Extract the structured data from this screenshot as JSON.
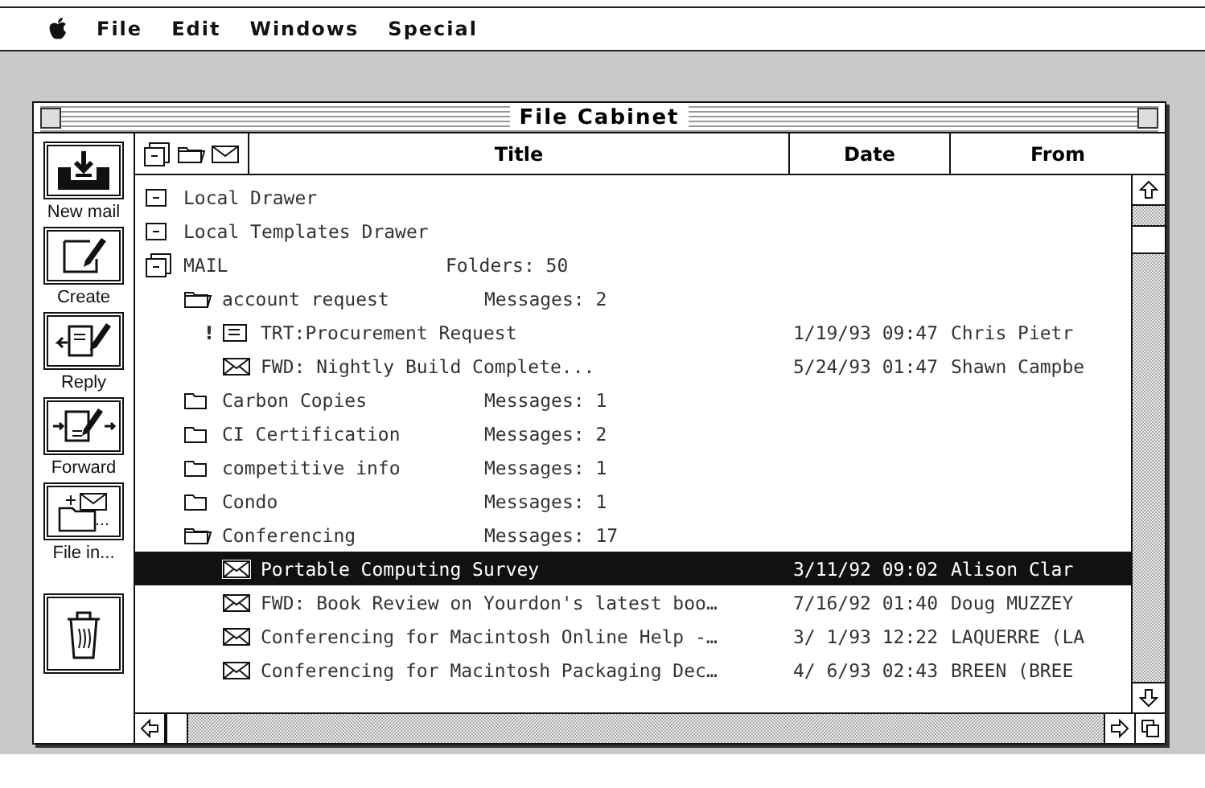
{
  "menu_bar": {
    "items": [
      "File",
      "Edit",
      "Windows",
      "Special"
    ]
  },
  "window": {
    "title": "File Cabinet"
  },
  "toolbar": [
    {
      "kind": "new-mail",
      "label": "New mail"
    },
    {
      "kind": "create",
      "label": "Create"
    },
    {
      "kind": "reply",
      "label": "Reply"
    },
    {
      "kind": "forward",
      "label": "Forward"
    },
    {
      "kind": "file-in",
      "label": "File in..."
    },
    {
      "kind": "trash"
    }
  ],
  "table": {
    "columns": [
      "Title",
      "Date",
      "From"
    ],
    "rows": [
      {
        "kind": "drawer",
        "title": "Local Drawer",
        "selected": false
      },
      {
        "kind": "drawer",
        "title": "Local Templates Drawer",
        "selected": false
      },
      {
        "kind": "cabinet",
        "title": "MAIL",
        "info": "Folders: 50",
        "selected": false,
        "children": [
          {
            "kind": "folder",
            "title": "account request",
            "info": "Messages: 2",
            "expanded": true,
            "selected": false,
            "children": [
              {
                "kind": "note",
                "flag": "!",
                "title": "TRT:Procurement Request",
                "date": "1/19/93 09:47",
                "from": "Chris Pietr",
                "selected": false
              },
              {
                "kind": "message",
                "title": "FWD: Nightly Build Complete...",
                "date": "5/24/93 01:47",
                "from": "Shawn Campbe",
                "selected": false
              }
            ]
          },
          {
            "kind": "folder",
            "title": "Carbon Copies",
            "info": "Messages: 1",
            "expanded": false,
            "selected": false
          },
          {
            "kind": "folder",
            "title": "CI Certification",
            "info": "Messages: 2",
            "expanded": false,
            "selected": false
          },
          {
            "kind": "folder",
            "title": "competitive info",
            "info": "Messages: 1",
            "expanded": false,
            "selected": false
          },
          {
            "kind": "folder",
            "title": "Condo",
            "info": "Messages: 1",
            "expanded": false,
            "selected": false
          },
          {
            "kind": "folder",
            "title": "Conferencing",
            "info": "Messages: 17",
            "expanded": true,
            "selected": false,
            "children": [
              {
                "kind": "message",
                "title": "Portable Computing Survey",
                "date": "3/11/92 09:02",
                "from": "Alison Clar",
                "selected": true
              },
              {
                "kind": "message",
                "title": "FWD: Book Review on Yourdon's latest boo…",
                "date": "7/16/92 01:40",
                "from": "Doug MUZZEY",
                "selected": false
              },
              {
                "kind": "message",
                "title": "Conferencing for Macintosh Online Help -…",
                "date": "3/ 1/93 12:22",
                "from": "LAQUERRE (LA",
                "selected": false
              },
              {
                "kind": "message",
                "title": "Conferencing for Macintosh Packaging Dec…",
                "date": "4/ 6/93 02:43",
                "from": "BREEN (BREE",
                "selected": false
              }
            ]
          }
        ]
      }
    ]
  }
}
